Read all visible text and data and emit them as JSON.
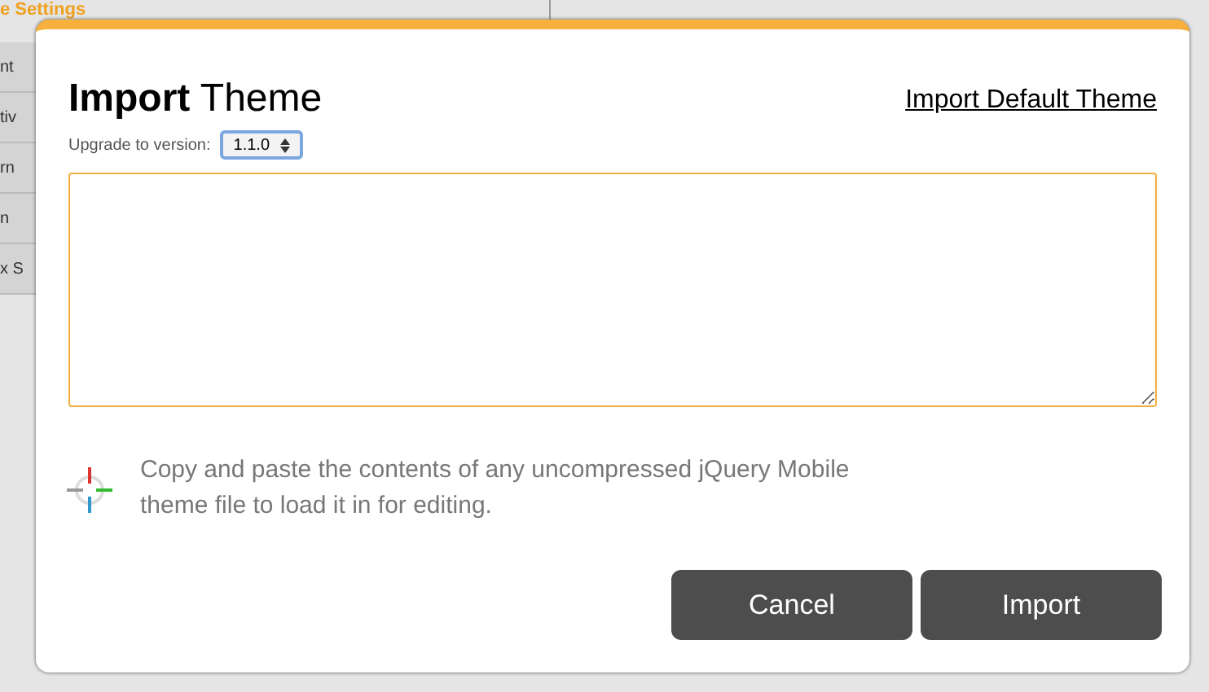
{
  "background": {
    "panel_title": "e Settings",
    "items": [
      "nt",
      "tiv",
      "rn",
      "n",
      "x S"
    ]
  },
  "dialog": {
    "title_bold": "Import",
    "title_rest": "Theme",
    "default_link": "Import Default Theme",
    "version_label": "Upgrade to version:",
    "version": "1.1.0",
    "help": "Copy and paste the contents of any uncompressed jQuery Mobile theme file to load it in for editing.",
    "buttons": [
      "Cancel",
      "Import"
    ]
  }
}
